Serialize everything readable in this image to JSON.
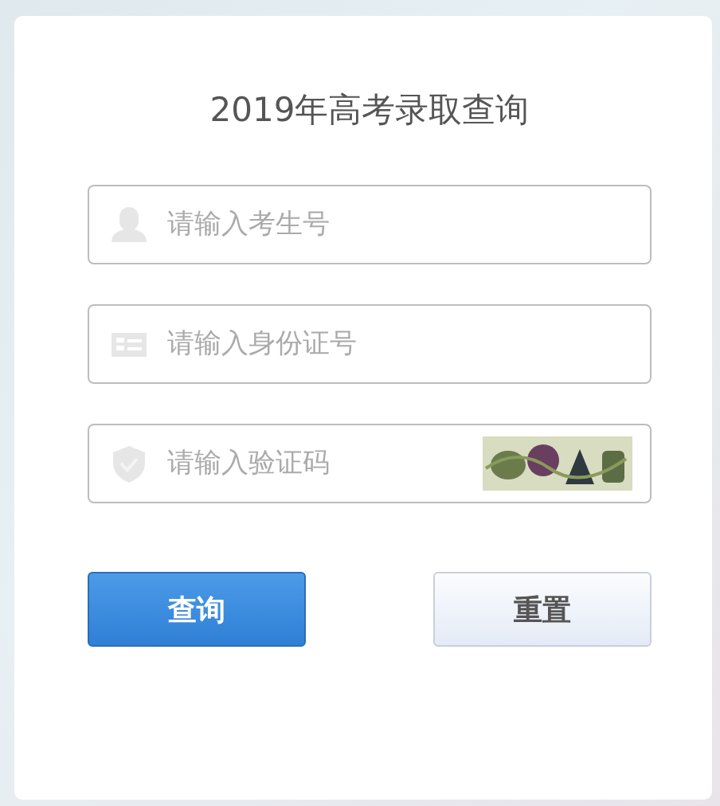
{
  "title": "2019年高考录取查询",
  "fields": [
    {
      "kind": "user",
      "placeholder": "请输入考生号"
    },
    {
      "kind": "id-card",
      "placeholder": "请输入身份证号"
    },
    {
      "kind": "captcha",
      "placeholder": "请输入验证码"
    }
  ],
  "buttons": [
    {
      "kind": "primary",
      "label": "查询"
    },
    {
      "kind": "secondary",
      "label": "重置"
    }
  ]
}
